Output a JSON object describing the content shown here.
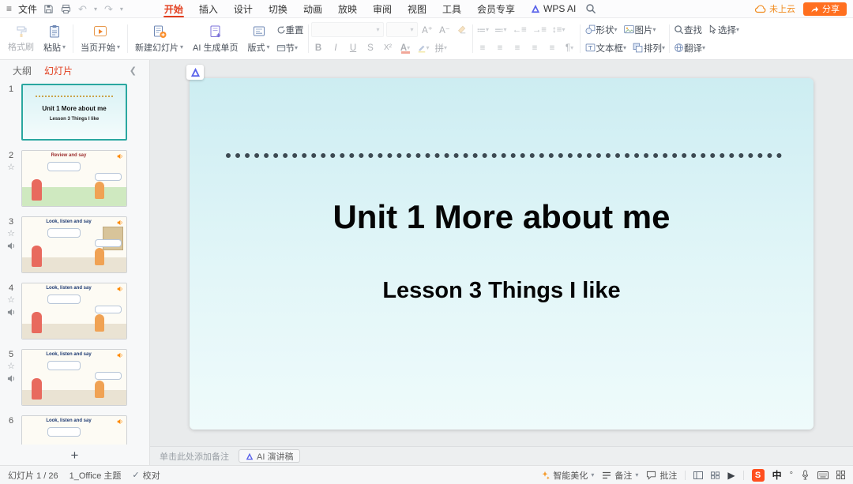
{
  "titlebar": {
    "file_menu": "文件",
    "tabs": [
      "开始",
      "插入",
      "设计",
      "切换",
      "动画",
      "放映",
      "审阅",
      "视图",
      "工具",
      "会员专享",
      "WPS AI"
    ],
    "cloud_status": "未上云",
    "share_label": "分享"
  },
  "ribbon": {
    "format_painter": "格式刷",
    "paste": "粘贴",
    "start_from_current": "当页开始",
    "new_slide": "新建幻灯片",
    "ai_generate_page": "AI 生成单页",
    "layout": "版式",
    "reset": "重置",
    "section": "节",
    "font": {
      "grow": "A⁺",
      "shrink": "A⁻",
      "bold": "B",
      "italic": "I",
      "underline": "U",
      "shadow": "S",
      "superscript": "X²",
      "color": "A",
      "phonetic": "拼"
    },
    "shape": "形状",
    "picture": "图片",
    "textbox": "文本框",
    "arrange": "排列",
    "find": "查找",
    "select": "选择",
    "translate": "翻译"
  },
  "sidebar": {
    "tab_outline": "大纲",
    "tab_slides": "幻灯片",
    "slides": [
      {
        "num": "1",
        "title": "Unit 1 More about me",
        "subtitle": "Lesson 3 Things I like"
      },
      {
        "num": "2",
        "title": "Review and say"
      },
      {
        "num": "3",
        "title": "Look, listen and say"
      },
      {
        "num": "4",
        "title": "Look, listen and say"
      },
      {
        "num": "5",
        "title": "Look, listen and say"
      },
      {
        "num": "6",
        "title": "Look, listen and say"
      }
    ]
  },
  "slide": {
    "title": "Unit 1 More about me",
    "subtitle": "Lesson 3 Things I like"
  },
  "notes": {
    "placeholder": "单击此处添加备注",
    "ai_script_label": "AI 演讲稿"
  },
  "statusbar": {
    "slide_counter": "幻灯片 1 / 26",
    "theme_name": "1_Office 主题",
    "proofing": "校对",
    "beautify": "智能美化",
    "notes_label": "备注",
    "comments_label": "批注",
    "ime_cn": "中"
  },
  "colors": {
    "accent_orange": "#ff6f1f",
    "active_tab_red": "#e23e1e",
    "thumb_selected_teal": "#2aa7a0",
    "slide_bg_top": "#cdedf2"
  }
}
